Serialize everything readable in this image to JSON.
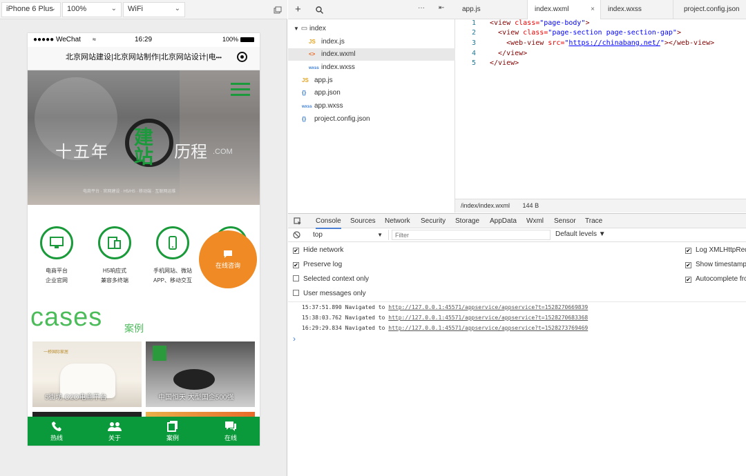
{
  "simulator": {
    "device": "iPhone 6 Plus",
    "zoom": "100%",
    "network": "WiFi",
    "status_carrier": "●●●●● WeChat",
    "status_time": "16:29",
    "status_battery": "100%",
    "nav_title": "北京网站建设|北京网站制作|北京网站设计|电",
    "nav_more": "•••",
    "hero_left": "十五年",
    "hero_brand": "建站",
    "hero_right": "历程",
    "hero_com": ".COM",
    "hero_sub": "电商平台 · 官网建设 · H5/H5 · 移动端 · 互联网运维",
    "services": [
      {
        "line1": "电商平台",
        "line2": "企业官网",
        "icon": "monitor-icon"
      },
      {
        "line1": "H5响应式",
        "line2": "兼容多终端",
        "icon": "responsive-icon"
      },
      {
        "line1": "手机网站、微站",
        "line2": "APP、移动交互",
        "icon": "phone-icon"
      }
    ],
    "consult_label": "在线咨询",
    "cases_title": "cases",
    "cases_subtitle": "案例",
    "case1_label": "5街坊 O2O电商平台",
    "case1_logo": "一桥国际家居",
    "case2_label": "中国恒天 大型国企500强",
    "tabbar": [
      {
        "label": "热线",
        "icon": "phone-call-icon"
      },
      {
        "label": "关于",
        "icon": "people-icon"
      },
      {
        "label": "案例",
        "icon": "cases-icon"
      },
      {
        "label": "在线",
        "icon": "chat-icon"
      }
    ]
  },
  "files": {
    "folder": "index",
    "items": [
      {
        "name": "index.js",
        "badge": "JS"
      },
      {
        "name": "index.wxml",
        "badge": "<>"
      },
      {
        "name": "index.wxss",
        "badge": "wxss"
      },
      {
        "name": "app.js",
        "badge": "JS"
      },
      {
        "name": "app.json",
        "badge": "{}"
      },
      {
        "name": "app.wxss",
        "badge": "wxss"
      },
      {
        "name": "project.config.json",
        "badge": "{}"
      }
    ]
  },
  "editor": {
    "tabs": [
      "app.js",
      "index.wxml",
      "index.wxss",
      "project.config.json"
    ],
    "active_tab": "index.wxml",
    "line_numbers": [
      "1",
      "2",
      "3",
      "4",
      "5"
    ],
    "path": "/index/index.wxml",
    "size": "144 B",
    "code": {
      "l1_tag": "<view ",
      "l1_attr": "class=",
      "l1_val": "\"page-body\"",
      "l1_end": ">",
      "l2_tag": "  <view ",
      "l2_attr": "class=",
      "l2_val": "\"page-section page-section-gap\"",
      "l2_end": ">",
      "l3_tag": "    <web-view ",
      "l3_attr": "src=",
      "l3_q1": "\"",
      "l3_url": "https://chinabang.net/",
      "l3_q2": "\"",
      "l3_end": "></web-view>",
      "l4": "  </view>",
      "l5": "</view>"
    }
  },
  "devtools": {
    "tabs": [
      "Console",
      "Sources",
      "Network",
      "Security",
      "Storage",
      "AppData",
      "Wxml",
      "Sensor",
      "Trace"
    ],
    "active_tab": "Console",
    "context": "top",
    "filter_placeholder": "Filter",
    "levels": "Default levels ▼",
    "options_left": [
      {
        "label": "Hide network",
        "checked": true
      },
      {
        "label": "Preserve log",
        "checked": true
      },
      {
        "label": "Selected context only",
        "checked": false
      },
      {
        "label": "User messages only",
        "checked": false
      }
    ],
    "options_right": [
      {
        "label": "Log XMLHttpReq",
        "checked": true
      },
      {
        "label": "Show timestamps",
        "checked": true
      },
      {
        "label": "Autocomplete fro",
        "checked": true
      }
    ],
    "logs": [
      {
        "time": "15:37:51.890",
        "text": "Navigated to",
        "url": "http://127.0.0.1:45571/appservice/appservice?t=1528270669839"
      },
      {
        "time": "15:38:03.762",
        "text": "Navigated to",
        "url": "http://127.0.0.1:45571/appservice/appservice?t=1528270683368"
      },
      {
        "time": "16:29:29.834",
        "text": "Navigated to",
        "url": "http://127.0.0.1:45571/appservice/appservice?t=1528273769469"
      }
    ],
    "prompt": "›"
  }
}
